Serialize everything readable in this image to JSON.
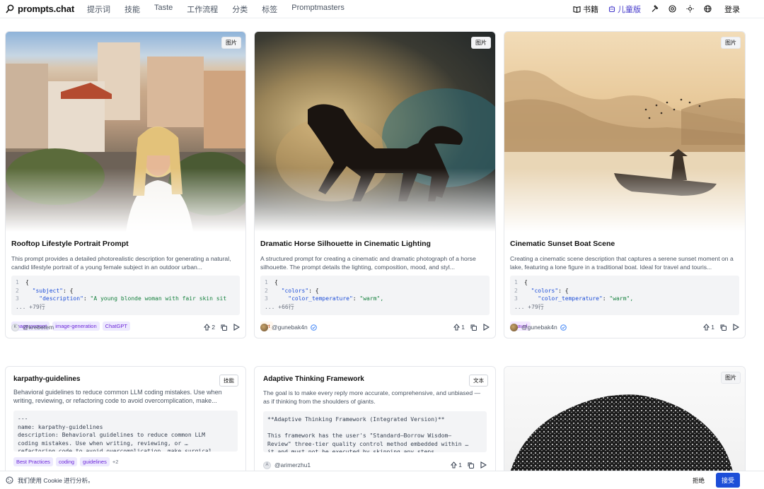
{
  "header": {
    "logo": "prompts.chat",
    "nav": [
      "提示词",
      "技能",
      "Taste",
      "工作流程",
      "分类",
      "标签",
      "Promptmasters"
    ],
    "books_label": "书籍",
    "kids_label": "儿童版",
    "login_label": "登录"
  },
  "cards": [
    {
      "badge": "图片",
      "title": "Rooftop Lifestyle Portrait Prompt",
      "description": "This prompt provides a detailed photorealistic description for generating a natural, candid lifestyle portrait of a young female subject in an outdoor urban...",
      "code": {
        "l1": "{",
        "l2_key": "\"subject\"",
        "l2_rest": ": {",
        "l3_key": "\"description\"",
        "l3_val": "\"A young blonde woman with fair skin sit",
        "more": "... +79行"
      },
      "tags": [
        "image-prompt",
        "image-generation",
        "ChatGPT"
      ],
      "author": "@krebetem",
      "avatar_initial": "K",
      "upvotes": "2"
    },
    {
      "badge": "图片",
      "title": "Dramatic Horse Silhouette in Cinematic Lighting",
      "description": "A structured prompt for creating a cinematic and dramatic photograph of a horse silhouette. The prompt details the lighting, composition, mood, and styl...",
      "code": {
        "l1": "{",
        "l2_key": "\"colors\"",
        "l2_rest": ": {",
        "l3_key": "\"color_temperature\"",
        "l3_val": "\"warm\",",
        "more": "... +66行"
      },
      "tags": [
        "Art"
      ],
      "author": "@gunebak4n",
      "upvotes": "1"
    },
    {
      "badge": "图片",
      "title": "Cinematic Sunset Boat Scene",
      "description": "Creating a cinematic scene description that captures a serene sunset moment on a lake, featuring a lone figure in a traditional boat. Ideal for travel and touris...",
      "code": {
        "l1": "{",
        "l2_key": "\"colors\"",
        "l2_rest": ": {",
        "l3_key": "\"color_temperature\"",
        "l3_val": "\"warm\",",
        "more": "... +79行"
      },
      "tags": [
        "Travel"
      ],
      "author": "@gunebak4n",
      "upvotes": "1"
    },
    {
      "badge": "技能",
      "title": "karpathy-guidelines",
      "description": "Behavioral guidelines to reduce common LLM coding mistakes. Use when writing, reviewing, or refactoring code to avoid overcomplication, make...",
      "code_text": "---\nname: karpathy-guidelines\ndescription: Behavioral guidelines to reduce common LLM\ncoding mistakes. Use when writing, reviewing, or …\nrefactoring code to avoid overcomplication, make surgical",
      "tags": [
        "Best Practices",
        "coding",
        "guidelines"
      ],
      "extra_tags": "+2"
    },
    {
      "badge": "文本",
      "title": "Adaptive Thinking Framework",
      "description": "The goal is to make every reply more accurate, comprehensive, and unbiased — as if thinking from the shoulders of giants.",
      "code_text": "**Adaptive Thinking Framework (Integrated Version)**\n\nThis framework has the user's \"Standard–Borrow Wisdom–\nReview\" three-tier quality control method embedded within …\nit and must not be executed by skipping any steps",
      "author": "@arimerzhu1",
      "avatar_initial": "A",
      "upvotes": "1"
    },
    {
      "badge": "图片"
    }
  ],
  "cookie": {
    "text": "我们使用 Cookie 进行分析。",
    "reject": "拒绝",
    "accept": "接受"
  }
}
